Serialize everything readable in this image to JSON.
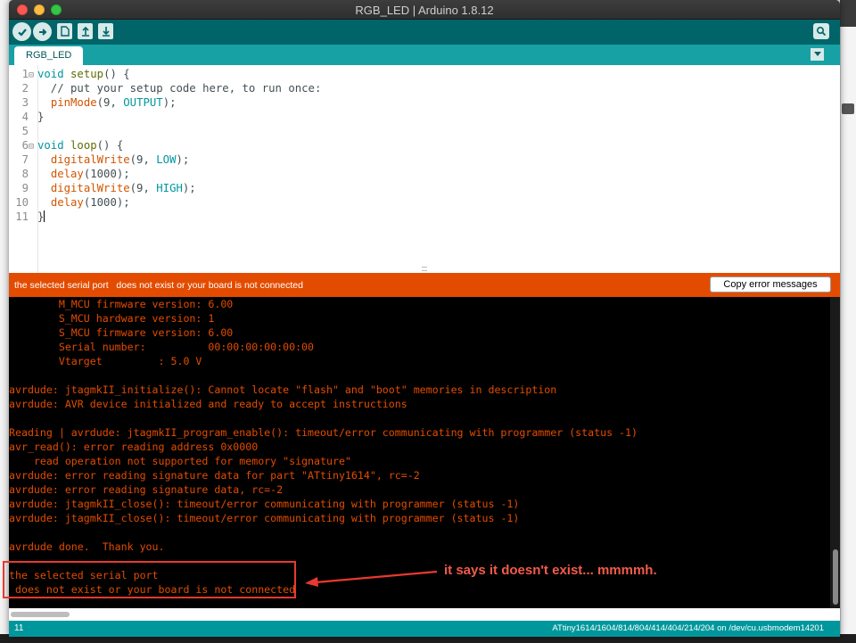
{
  "window": {
    "title": "RGB_LED | Arduino 1.8.12"
  },
  "toolbar": {
    "verify_icon": "checkmark-icon",
    "upload_icon": "arrow-right-icon",
    "new_icon": "new-file-icon",
    "open_icon": "open-arrow-up-icon",
    "save_icon": "save-arrow-down-icon",
    "serial_monitor_icon": "magnifier-icon"
  },
  "tabs": [
    {
      "label": "RGB_LED"
    }
  ],
  "editor": {
    "lines": [
      {
        "n": "1",
        "text": "void setup() {"
      },
      {
        "n": "2",
        "text": "  // put your setup code here, to run once:"
      },
      {
        "n": "3",
        "text": "  pinMode(9, OUTPUT);"
      },
      {
        "n": "4",
        "text": "}"
      },
      {
        "n": "5",
        "text": ""
      },
      {
        "n": "6",
        "text": "void loop() {"
      },
      {
        "n": "7",
        "text": "  digitalWrite(9, LOW);"
      },
      {
        "n": "8",
        "text": "  delay(1000);"
      },
      {
        "n": "9",
        "text": "  digitalWrite(9, HIGH);"
      },
      {
        "n": "10",
        "text": "  delay(1000);"
      },
      {
        "n": "11",
        "text": "}"
      }
    ]
  },
  "status": {
    "message": "the selected serial port   does not exist or your board is not connected",
    "copy_button": "Copy error messages"
  },
  "console": {
    "lines": [
      "        M_MCU firmware version: 6.00",
      "        S_MCU hardware version: 1",
      "        S_MCU firmware version: 6.00",
      "        Serial number:          00:00:00:00:00:00",
      "        Vtarget         : 5.0 V",
      "",
      "avrdude: jtagmkII_initialize(): Cannot locate \"flash\" and \"boot\" memories in description",
      "avrdude: AVR device initialized and ready to accept instructions",
      "",
      "Reading | avrdude: jtagmkII_program_enable(): timeout/error communicating with programmer (status -1)",
      "avr_read(): error reading address 0x0000",
      "    read operation not supported for memory \"signature\"",
      "avrdude: error reading signature data for part \"ATtiny1614\", rc=-2",
      "avrdude: error reading signature data, rc=-2",
      "avrdude: jtagmkII_close(): timeout/error communicating with programmer (status -1)",
      "avrdude: jtagmkII_close(): timeout/error communicating with programmer (status -1)",
      "",
      "avrdude done.  Thank you.",
      "",
      "the selected serial port",
      " does not exist or your board is not connected"
    ]
  },
  "bottom_bar": {
    "line_number": "11",
    "board_info": "ATtiny1614/1604/814/804/414/404/214/204 on /dev/cu.usbmodem14201"
  },
  "annotation": {
    "text": "it says it doesn't exist... mmmmh."
  },
  "colors": {
    "toolbar": "#006468",
    "tabrow": "#17a1a5",
    "status_error": "#e34c00",
    "console_text": "#e34c00",
    "annotation": "#e8392f"
  }
}
